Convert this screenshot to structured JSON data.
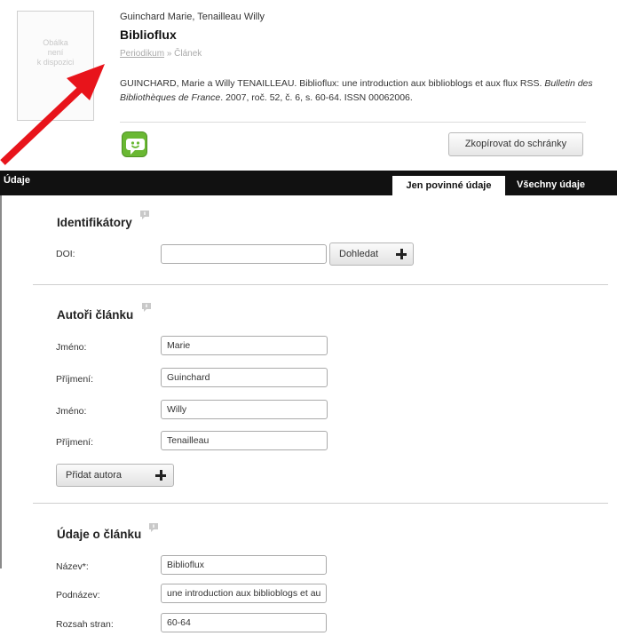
{
  "record": {
    "cover_text": "Obálka\nnení\nk dispozici",
    "authors": "Guinchard Marie, Tenailleau Willy",
    "title": "Biblioflux",
    "crumb_link": "Periodikum",
    "crumb_sep": "»",
    "crumb_current": "Článek",
    "citation_part1": "GUINCHARD, Marie a Willy TENAILLEAU. Biblioflux: une introduction aux biblioblogs et aux flux RSS.",
    "citation_journal": "Bulletin des Bibliothèques de France",
    "citation_part2": ". 2007, roč. 52, č. 6, s. 60-64. ISSN 00062006.",
    "copy_button": "Zkopírovat do schránky"
  },
  "colors": {
    "chat_green": "#6ab833",
    "arrow_red": "#e8141b",
    "bar": "#111111"
  },
  "tabbar": {
    "title": "Údaje",
    "tab_required": "Jen povinné údaje",
    "tab_all": "Všechny údaje"
  },
  "identifiers": {
    "title": "Identifikátory",
    "doi_label": "DOI:",
    "doi_value": "",
    "lookup_button": "Dohledat"
  },
  "authors": {
    "title": "Autoři článku",
    "rows": [
      {
        "label": "Jméno:",
        "value": "Marie"
      },
      {
        "label": "Příjmení:",
        "value": "Guinchard"
      },
      {
        "label": "Jméno:",
        "value": "Willy"
      },
      {
        "label": "Příjmení:",
        "value": "Tenailleau"
      }
    ],
    "add_button": "Přidat autora"
  },
  "article": {
    "title": "Údaje o článku",
    "rows": [
      {
        "label": "Název*:",
        "value": "Biblioflux"
      },
      {
        "label": "Podnázev:",
        "value": "une introduction aux biblioblogs et aux flux RSS"
      },
      {
        "label": "Rozsah stran:",
        "value": "60-64"
      }
    ]
  }
}
